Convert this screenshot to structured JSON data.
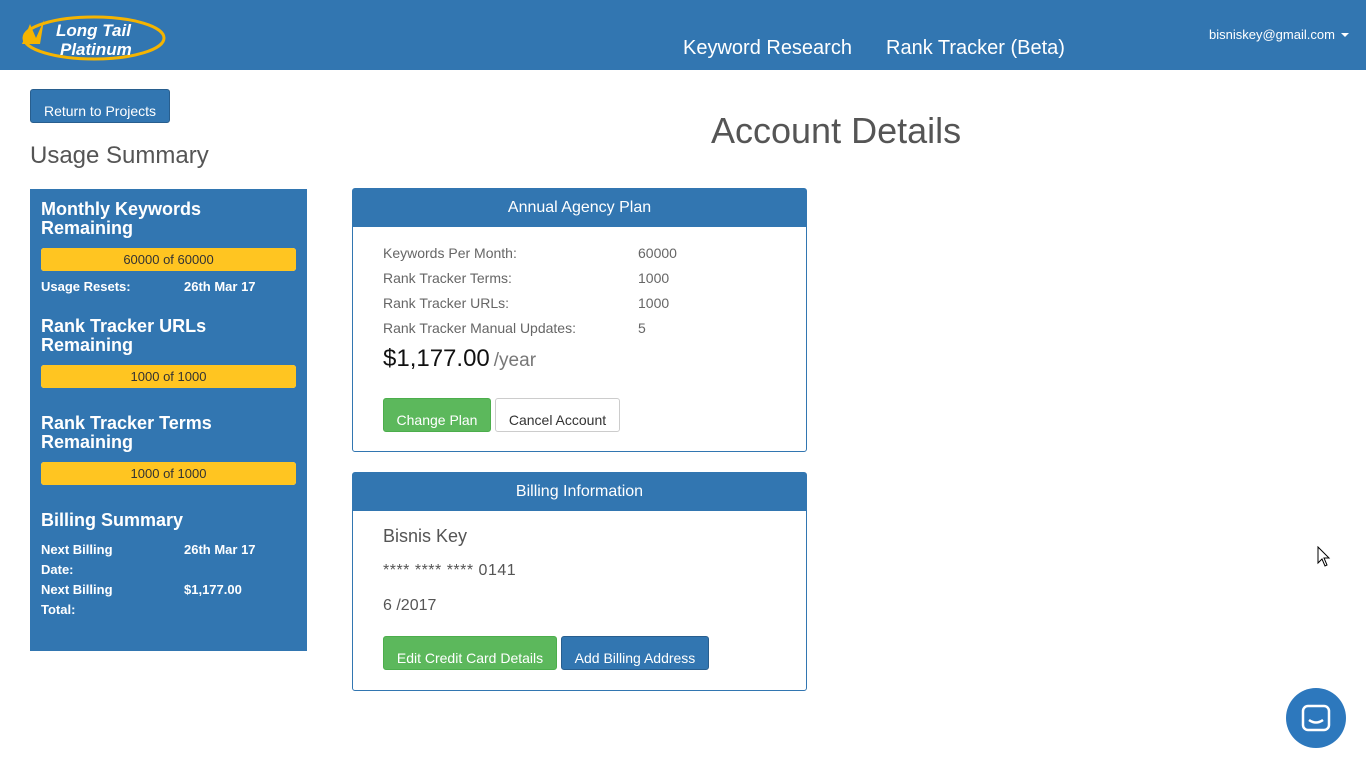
{
  "header": {
    "logo_line1": "Long Tail",
    "logo_line2": "Platinum",
    "nav": [
      {
        "label": "Keyword Research"
      },
      {
        "label": "Rank Tracker (Beta)"
      }
    ],
    "user_email": "bisniskey@gmail.com"
  },
  "sidebar": {
    "return_label": "Return to Projects",
    "usage_title": "Usage Summary",
    "keywords": {
      "heading": "Monthly Keywords Remaining",
      "bar_text": "60000 of 60000",
      "fill_fraction": 1.0,
      "resets_label": "Usage Resets:",
      "resets_value": "26th Mar 17"
    },
    "rt_urls": {
      "heading": "Rank Tracker URLs Remaining",
      "bar_text": "1000 of 1000",
      "fill_fraction": 1.0
    },
    "rt_terms": {
      "heading": "Rank Tracker Terms Remaining",
      "bar_text": "1000 of 1000",
      "fill_fraction": 1.0
    },
    "billing": {
      "heading": "Billing Summary",
      "next_date_label": "Next Billing Date:",
      "next_date_value": "26th Mar 17",
      "next_total_label": "Next Billing Total:",
      "next_total_value": "$1,177.00"
    }
  },
  "main": {
    "title": "Account Details",
    "plan": {
      "header": "Annual Agency Plan",
      "rows": [
        {
          "label": "Keywords Per Month:",
          "value": "60000"
        },
        {
          "label": "Rank Tracker Terms:",
          "value": "1000"
        },
        {
          "label": "Rank Tracker URLs:",
          "value": "1000"
        },
        {
          "label": "Rank Tracker Manual Updates:",
          "value": "5"
        }
      ],
      "price": "$1,177.00",
      "per": "/year",
      "change_label": "Change Plan",
      "cancel_label": "Cancel Account"
    },
    "billing": {
      "header": "Billing Information",
      "name": "Bisnis Key",
      "card": "**** **** **** 0141",
      "expiry": "6 /2017",
      "edit_label": "Edit Credit Card Details",
      "address_label": "Add Billing Address"
    }
  },
  "colors": {
    "brand_blue": "#3276b1",
    "success_green": "#5cb85c",
    "bar_yellow": "#ffc521"
  },
  "icons": {
    "chat": "chat-icon",
    "cursor": "mouse-cursor-icon"
  }
}
